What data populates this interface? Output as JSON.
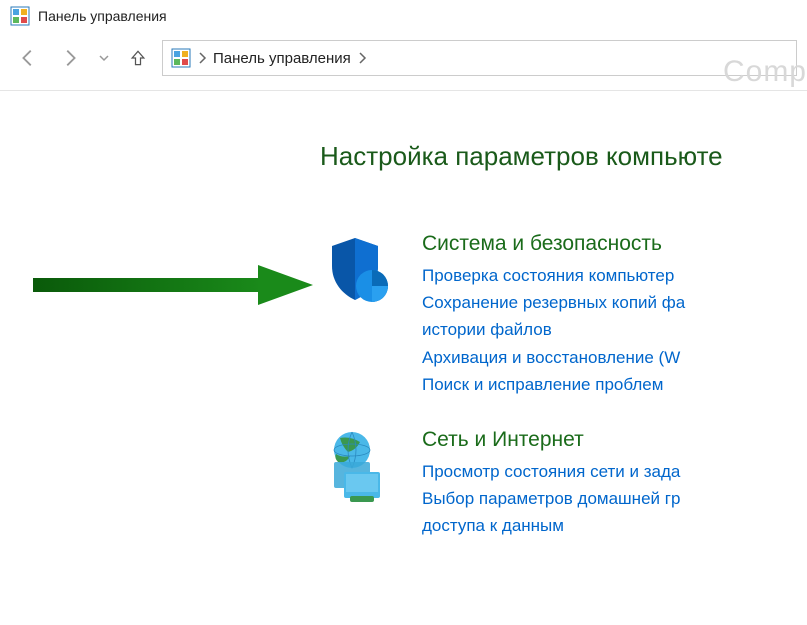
{
  "window": {
    "title": "Панель управления"
  },
  "breadcrumb": {
    "current": "Панель управления"
  },
  "watermark": "Comp",
  "page": {
    "heading": "Настройка параметров компьюте"
  },
  "categories": [
    {
      "title": "Система и безопасность",
      "links": [
        "Проверка состояния компьютер",
        "Сохранение резервных копий фа",
        "истории файлов",
        "Архивация и восстановление (W",
        "Поиск и исправление проблем"
      ]
    },
    {
      "title": "Сеть и Интернет",
      "links": [
        "Просмотр состояния сети и зада",
        "Выбор параметров домашней гр",
        "доступа к данным"
      ]
    }
  ]
}
